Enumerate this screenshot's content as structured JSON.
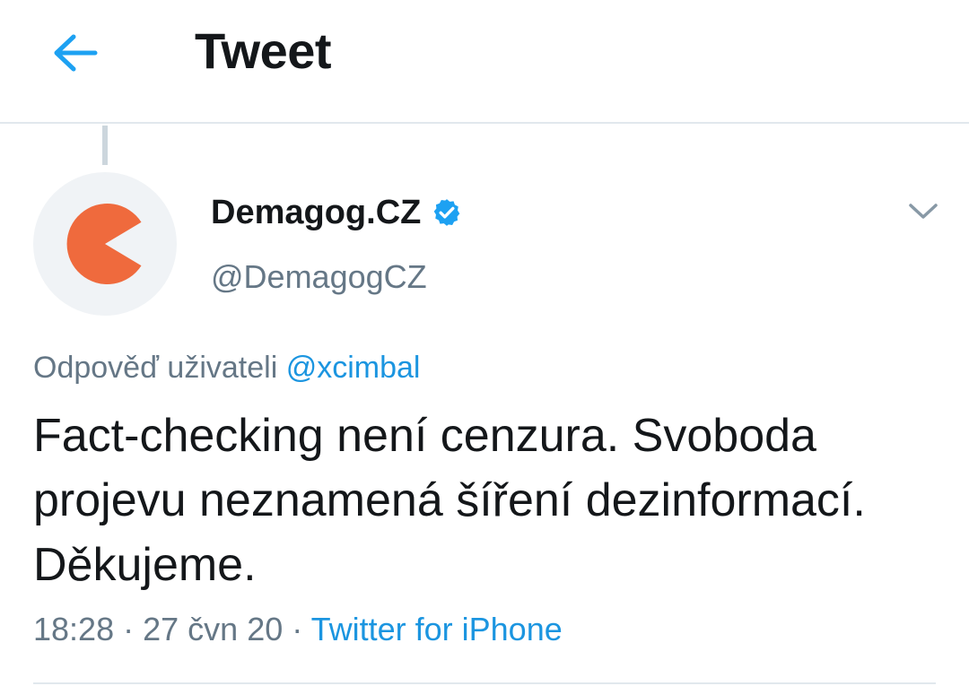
{
  "header": {
    "title": "Tweet",
    "back_icon": "arrow-left-icon",
    "accent_color": "#1da1f2"
  },
  "tweet": {
    "avatar": {
      "icon": "demagog-pacman-logo",
      "logo_color": "#ef6a3d"
    },
    "display_name": "Demagog.CZ",
    "verified": true,
    "handle": "@DemagogCZ",
    "reply_prefix": "Odpověď uživateli",
    "reply_to": "@xcimbal",
    "text": "Fact-checking není cenzura. Svoboda\nprojevu neznamená šíření dezinformací.\nDěkujeme.",
    "time": "18:28",
    "separator": "·",
    "date": "27 čvn 20",
    "source": "Twitter for iPhone",
    "caret_icon": "chevron-down-icon"
  }
}
